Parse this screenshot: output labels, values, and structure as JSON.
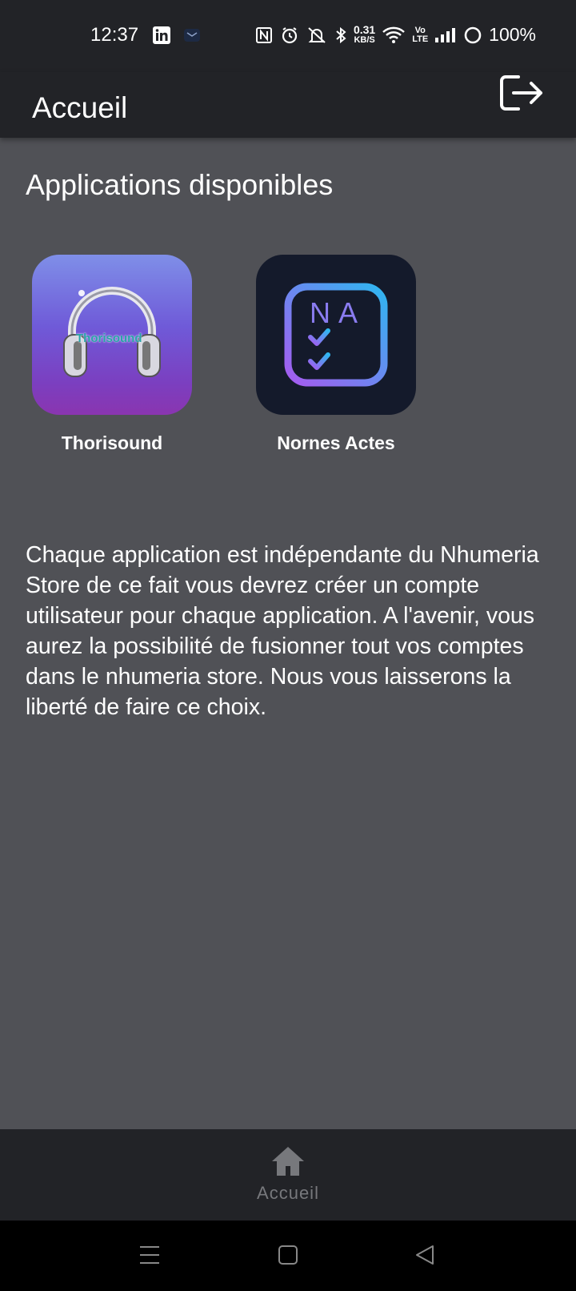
{
  "status_bar": {
    "time": "12:37",
    "net_speed_top": "0.31",
    "net_speed_bottom": "KB/S",
    "volte_top": "Vo",
    "volte_bottom": "LTE",
    "battery": "100%",
    "icons": [
      "linkedin-icon",
      "mail-icon",
      "nfc-icon",
      "alarm-icon",
      "silent-icon",
      "bluetooth-icon",
      "wifi-icon",
      "signal-icon",
      "battery-icon"
    ]
  },
  "appbar": {
    "title": "Accueil"
  },
  "main": {
    "section_title": "Applications disponibles",
    "apps": [
      {
        "name": "Thorisound",
        "icon_text": "Thorisound"
      },
      {
        "name": "Nornes Actes",
        "icon_text": "NA"
      }
    ],
    "info": "Chaque application est indépendante du Nhumeria Store de ce fait vous devrez créer un compte utilisateur pour chaque application. A l'avenir, vous aurez la possibilité de fusionner tout vos comptes dans le nhumeria store. Nous vous laisserons la liberté de faire ce choix."
  },
  "bottom_nav": {
    "home_label": "Accueil"
  },
  "colors": {
    "background": "#505156",
    "bars": "#222327",
    "nav_inactive": "#77787c",
    "na_icon_bg": "#141a2b"
  }
}
